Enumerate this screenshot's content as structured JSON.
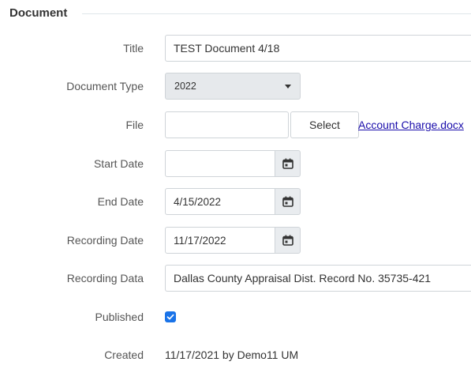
{
  "section": {
    "title": "Document"
  },
  "fields": {
    "title": {
      "label": "Title",
      "value": "TEST Document 4/18"
    },
    "document_type": {
      "label": "Document Type",
      "selected": "2022"
    },
    "file": {
      "label": "File",
      "value": "",
      "select_label": "Select",
      "link_text": "Account Charge.docx"
    },
    "start_date": {
      "label": "Start Date",
      "value": "",
      "icon": "calendar-icon"
    },
    "end_date": {
      "label": "End Date",
      "value": "4/15/2022",
      "icon": "calendar-icon"
    },
    "recording_date": {
      "label": "Recording Date",
      "value": "11/17/2022",
      "icon": "calendar-icon"
    },
    "recording_data": {
      "label": "Recording Data",
      "value": "Dallas County Appraisal Dist. Record No. 35735-421"
    },
    "published": {
      "label": "Published",
      "checked": true,
      "icon": "checkmark-icon"
    },
    "created": {
      "label": "Created",
      "value": "11/17/2021 by Demo11 UM"
    }
  },
  "colors": {
    "accent": "#1a73e8",
    "link": "#1a0dab",
    "disabled_bg": "#e6e9ec",
    "addon_bg": "#e9ecef"
  }
}
